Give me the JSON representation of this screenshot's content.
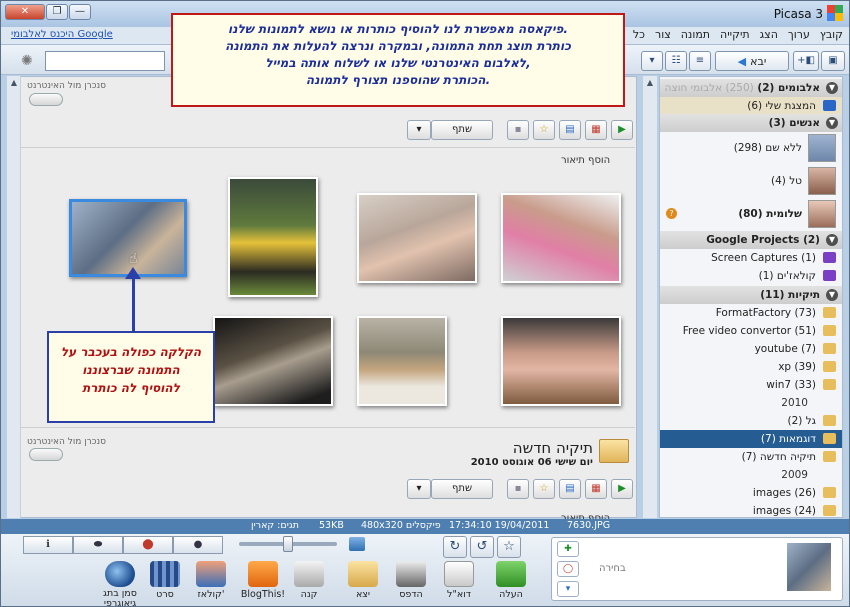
{
  "window": {
    "title": "Picasa 3",
    "controls": [
      "—",
      "❐",
      "✕"
    ]
  },
  "menu": {
    "items": [
      "קובץ",
      "ערוך",
      "הצג",
      "תיקייה",
      "תמונה",
      "צור",
      "כל"
    ],
    "google_link": "היכנס לאלבומי Google"
  },
  "toolbar": {
    "import_label": "יבא"
  },
  "sync": {
    "label": "סנכרן מול האינטרנט"
  },
  "action_bar": {
    "share_label": "שתף"
  },
  "album": {
    "add_caption": "הוסף תיאור",
    "title": "תיקיה חדשה",
    "date": "יום שישי 06 אוגוסט 2010",
    "add_caption_bottom": "הוסף תיאור"
  },
  "tree": {
    "albums_header": "אלבומים (2)",
    "albums_faded": "(250) אלבומי חוצה",
    "albums": [
      "המצגת שלי (6)"
    ],
    "people_header": "אנשים (3)",
    "people": [
      {
        "label": "ללא שם (298)"
      },
      {
        "label": "טל (4)"
      },
      {
        "label": "שלומית (80)"
      }
    ],
    "projects_header": "Google Projects (2)",
    "projects": [
      "Screen Captures (1)",
      "קולאז'ים (1)"
    ],
    "folders_header": "תיקיות (11)",
    "folders": [
      "FormatFactory (73)",
      "Free video convertor (51)",
      "youtube (7)",
      "xp (39)",
      "win7 (33)"
    ],
    "year_2010": "2010",
    "folders_2010": [
      "גל (2)",
      "דוגמאות (7)",
      "תיקיה חדשה (7)"
    ],
    "year_2009": "2009",
    "folders_2009": [
      "images (26)",
      "images (24)"
    ]
  },
  "status": {
    "tags": "תגים: קארין",
    "size": "53KB",
    "dimensions": "480x320 פיקסלים",
    "datetime": "17:34:10 19/04/2011",
    "filename": "7630.JPG"
  },
  "tray": {
    "tools": [
      "העלה",
      "דוא\"ל",
      "הדפס",
      "יצא",
      "קנה",
      "BlogThis!",
      "קולאז'",
      "סרט",
      "סמן בתג גיאוגרפי"
    ],
    "selection_label": "בחירה"
  },
  "annotations": {
    "top": [
      "פיקאסה מאפשרת לנו להוסיף כותרות או נושא לתמונות שלנו.",
      "כותרת תוצג תחת התמונה, ובמקרה ונרצה להעלות את התמונה",
      "לאלבום האינטרנטי שלנו או לשלוח אותה במייל,",
      "הכותרת שהוספנו תצורף לתמונה."
    ],
    "bottom": [
      "הקלקה כפולה בעכבר על",
      "התמונה שברצוננו",
      "להוסיף לה כותרת"
    ]
  }
}
